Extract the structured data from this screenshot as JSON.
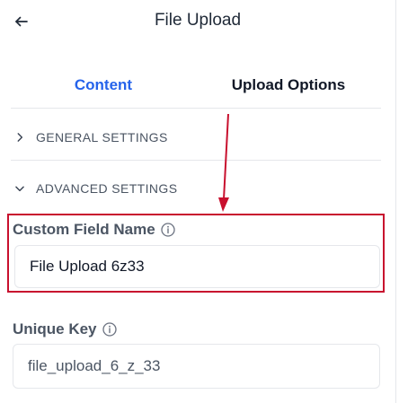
{
  "header": {
    "title": "File Upload",
    "back_icon": "arrow-left-icon"
  },
  "tabs": [
    {
      "label": "Content",
      "active": true
    },
    {
      "label": "Upload Options",
      "active": false
    }
  ],
  "sections": {
    "general": {
      "label": "GENERAL SETTINGS",
      "icon": "chevron-right-icon",
      "expanded": false
    },
    "advanced": {
      "label": "ADVANCED SETTINGS",
      "icon": "chevron-down-icon",
      "expanded": true
    }
  },
  "fields": {
    "custom_field_name": {
      "label": "Custom Field Name",
      "value": "File Upload 6z33",
      "info_icon": "info-icon"
    },
    "unique_key": {
      "label": "Unique Key",
      "value": "file_upload_6_z_33",
      "info_icon": "info-icon"
    }
  },
  "colors": {
    "accent": "#2563eb",
    "annotation": "#c8102e",
    "border": "#e5e7eb",
    "muted_text": "#4b5563"
  }
}
